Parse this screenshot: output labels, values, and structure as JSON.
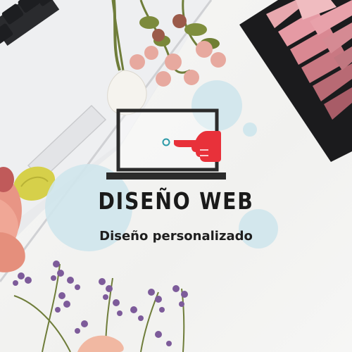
{
  "logo": {
    "title": "DISEÑO WEB",
    "subtitle": "Diseño personalizado",
    "icon": "laptop-pointing-hand-icon"
  },
  "colors": {
    "accent_red": "#e8313a",
    "accent_teal": "#2c9aa8",
    "circle_blue": "#cfe6ec",
    "laptop_outline": "#2b2b2b"
  }
}
